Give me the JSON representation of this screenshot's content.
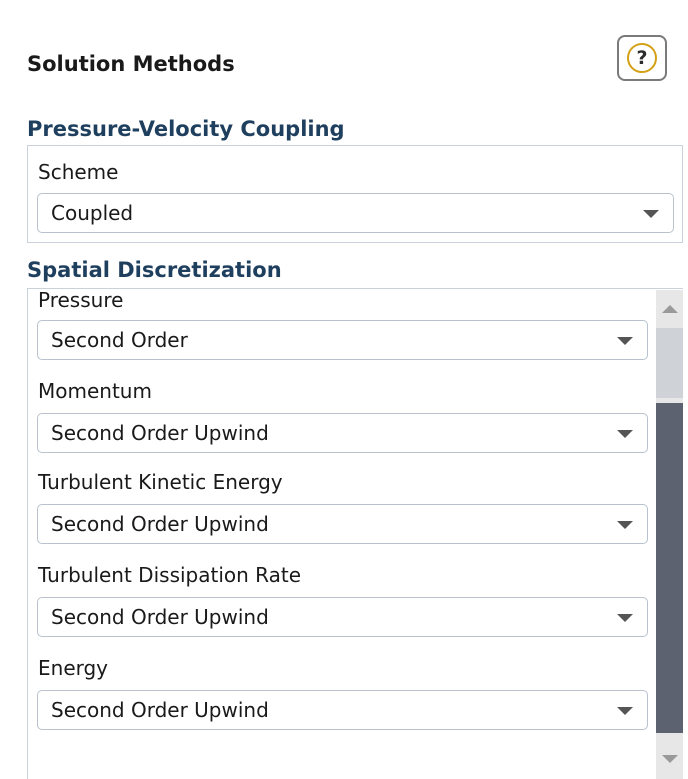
{
  "panel": {
    "title": "Solution Methods",
    "help_label": "?"
  },
  "pressure_velocity_coupling": {
    "title": "Pressure-Velocity Coupling",
    "scheme_label": "Scheme",
    "scheme_value": "Coupled"
  },
  "spatial_discretization": {
    "title": "Spatial Discretization",
    "fields": [
      {
        "label": "Pressure",
        "value": "Second Order"
      },
      {
        "label": "Momentum",
        "value": "Second Order Upwind"
      },
      {
        "label": "Turbulent Kinetic Energy",
        "value": "Second Order Upwind"
      },
      {
        "label": "Turbulent Dissipation Rate",
        "value": "Second Order Upwind"
      },
      {
        "label": "Energy",
        "value": "Second Order Upwind"
      }
    ]
  },
  "icons": {
    "help": "help-icon",
    "dropdown_arrow": "chevron-down-icon",
    "scroll_up": "scroll-up-arrow-icon",
    "scroll_down": "scroll-down-arrow-icon"
  },
  "colors": {
    "section_title": "#1f3f5e",
    "help_ring": "#d4a017",
    "scroll_thumb": "#5c6270",
    "border": "#c9d1da"
  }
}
